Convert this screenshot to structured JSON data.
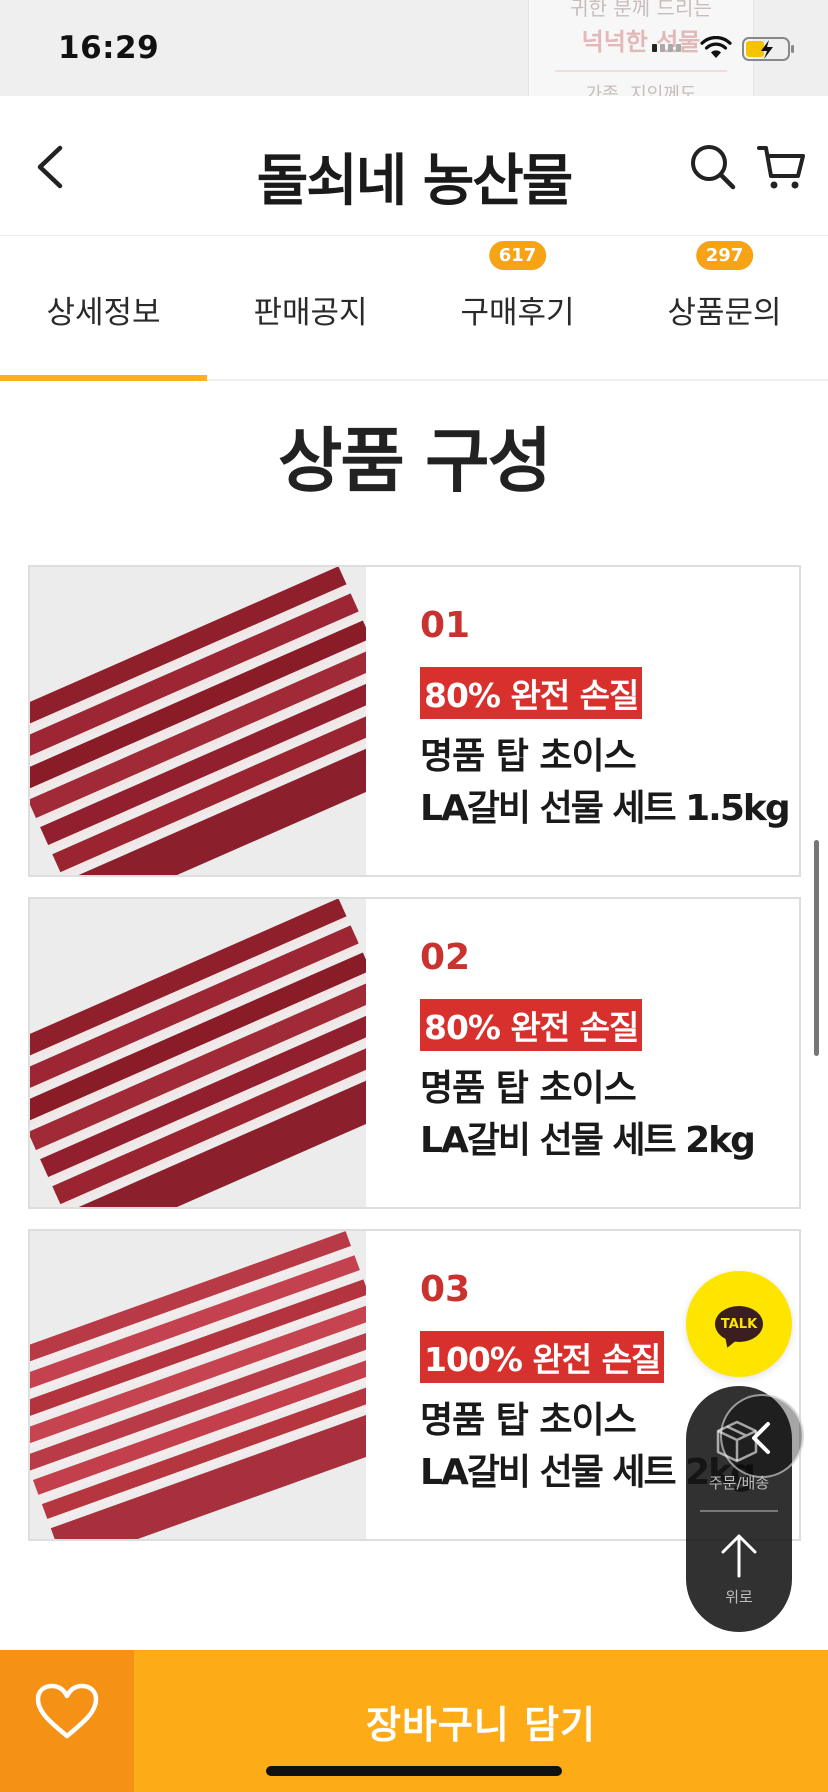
{
  "status_bar": {
    "time": "16:29",
    "peek_text": [
      "귀한 분께 드리는",
      "넉넉한 선물",
      "가족, 지인께도"
    ]
  },
  "header": {
    "title": "돌쇠네 농산물",
    "icons": [
      "back-icon",
      "search-icon",
      "cart-icon"
    ]
  },
  "tabs": [
    {
      "label": "상세정보",
      "badge": null,
      "active": true
    },
    {
      "label": "판매공지",
      "badge": null,
      "active": false
    },
    {
      "label": "구매후기",
      "badge": "617",
      "active": false
    },
    {
      "label": "상품문의",
      "badge": "297",
      "active": false
    }
  ],
  "section_title": "상품 구성",
  "products": [
    {
      "number": "01",
      "tag": "80% 완전 손질",
      "name_line1": "명품 탑 초이스",
      "name_line2": "LA갈비 선물 세트 1.5kg"
    },
    {
      "number": "02",
      "tag": "80% 완전 손질",
      "name_line1": "명품 탑 초이스",
      "name_line2": "LA갈비 선물 세트 2kg"
    },
    {
      "number": "03",
      "tag": "100% 완전 손질",
      "name_line1": "명품 탑 초이스",
      "name_line2": "LA갈비 선물 세트 2kg"
    }
  ],
  "floating": {
    "talk_label": "TALK",
    "order_label": "주문/배송",
    "top_label": "위로"
  },
  "bottom_bar": {
    "add_to_cart_label": "장바구니 담기",
    "icons": [
      "heart-icon"
    ]
  },
  "colors": {
    "accent": "#f8b31a",
    "badge": "#f6a316",
    "tag_red": "#d8312d",
    "kakao_yellow": "#fee500",
    "wish_orange": "#f59115",
    "cart_orange": "#fdab16"
  }
}
